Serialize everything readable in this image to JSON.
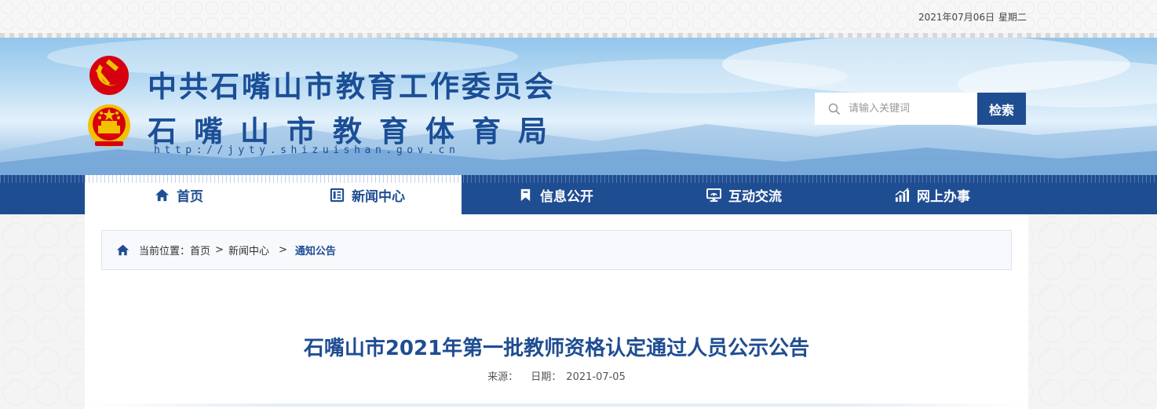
{
  "topbar": {
    "date": "2021年07月06日",
    "weekday": "星期二"
  },
  "header": {
    "title_line1": "中共石嘴山市教育工作委员会",
    "title_line2": "石嘴山市教育体育局",
    "domain": "http://jyty.shizuishan.gov.cn",
    "search": {
      "placeholder": "请输入关键词",
      "button_label": "检索"
    }
  },
  "nav": {
    "items": [
      {
        "label": "首页",
        "icon": "home-icon"
      },
      {
        "label": "新闻中心",
        "icon": "news-list-icon"
      },
      {
        "label": "信息公开",
        "icon": "bookmark-icon"
      },
      {
        "label": "互动交流",
        "icon": "monitor-icon"
      },
      {
        "label": "网上办事",
        "icon": "bar-chart-icon"
      }
    ]
  },
  "breadcrumb": {
    "prefix": "当前位置：",
    "items": [
      "首页",
      "新闻中心",
      "通知公告"
    ],
    "separator": ">"
  },
  "article": {
    "title": "石嘴山市2021年第一批教师资格认定通过人员公示公告",
    "source_label": "来源：",
    "source_value": "",
    "date_label": "日期：",
    "date_value": "2021-07-05"
  },
  "colors": {
    "brand_blue": "#1f4d92",
    "emblem_red": "#d7000f",
    "emblem_gold": "#f2c200"
  }
}
